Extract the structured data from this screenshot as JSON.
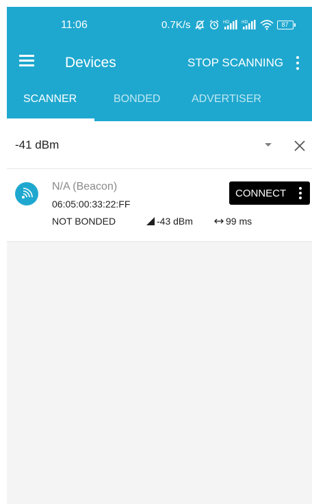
{
  "status_bar": {
    "time": "11:06",
    "net_speed": "0.7K/s",
    "battery": "87"
  },
  "toolbar": {
    "title": "Devices",
    "stop_scanning": "STOP SCANNING"
  },
  "tabs": [
    {
      "label": "SCANNER",
      "active": true
    },
    {
      "label": "BONDED",
      "active": false
    },
    {
      "label": "ADVERTISER",
      "active": false
    }
  ],
  "filter": {
    "value": "-41 dBm"
  },
  "device": {
    "name": "N/A (Beacon)",
    "address": "06:05:00:33:22:FF",
    "bond_state": "NOT BONDED",
    "rssi": "-43 dBm",
    "interval": "99 ms",
    "connect_label": "CONNECT"
  },
  "colors": {
    "primary": "#1fa8cf",
    "background": "#f4f4f4",
    "connect_button": "#000000"
  },
  "icons": [
    "menu-icon",
    "overflow-menu-icon",
    "dropdown-arrow-icon",
    "close-icon",
    "beacon-icon",
    "signal-icon",
    "interval-icon"
  ]
}
